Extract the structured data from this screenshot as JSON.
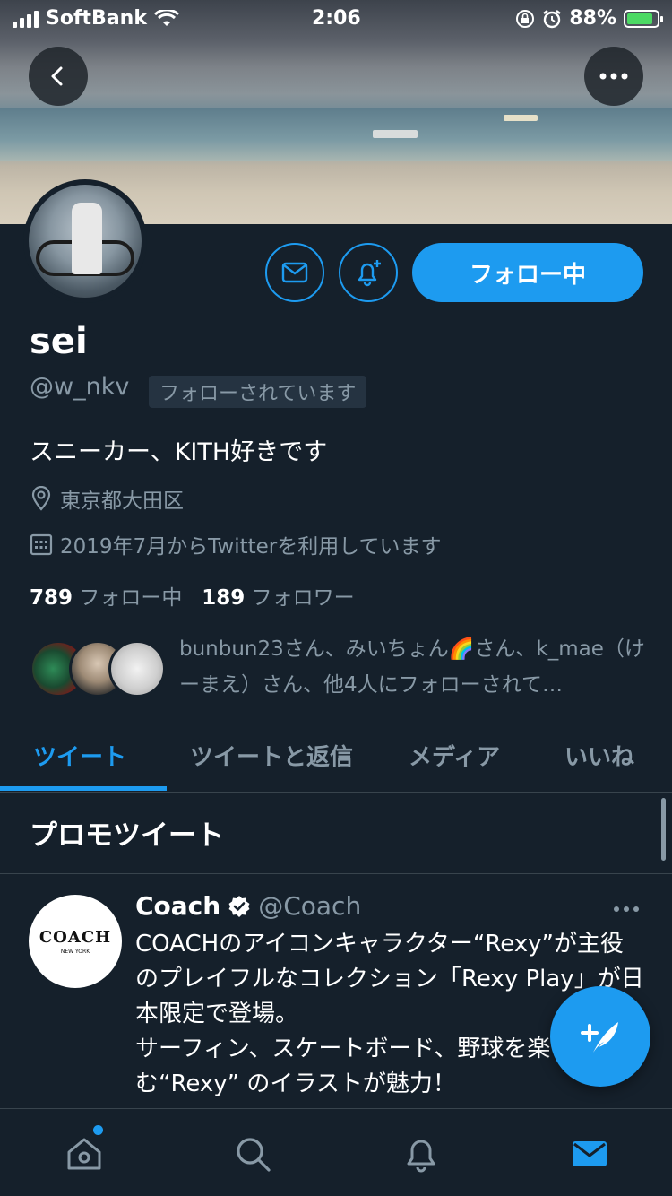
{
  "status_bar": {
    "carrier": "SoftBank",
    "time": "2:06",
    "battery": "88%"
  },
  "profile": {
    "name": "sei",
    "handle": "@w_nkv",
    "follows_you": "フォローされています",
    "bio": "スニーカー、KITH好きです",
    "location": "東京都大田区",
    "joined": "2019年7月からTwitterを利用しています",
    "following_count": "789",
    "following_label": "フォロー中",
    "followers_count": "189",
    "followers_label": "フォロワー",
    "follow_button": "フォロー中",
    "mutuals_text": "bunbun23さん、みいちょん🌈さん、k_mae（けーまえ）さん、他4人にフォローされて…"
  },
  "tabs": [
    {
      "label": "ツイート"
    },
    {
      "label": "ツイートと返信"
    },
    {
      "label": "メディア"
    },
    {
      "label": "いいね"
    }
  ],
  "promo": {
    "heading": "プロモツイート",
    "tweet": {
      "name": "Coach",
      "handle": "@Coach",
      "avatar_logo": "COACH",
      "avatar_sub": "NEW YORK",
      "text": "COACHのアイコンキャラクター“Rexy”が主役のプレイフルなコレクション「Rexy Play」が日本限定で登場。\nサーフィン、スケートボード、野球を楽しむ“Rexy” のイラストが魅力！"
    }
  },
  "colors": {
    "accent": "#1d9bf0",
    "background": "#15202b",
    "muted": "#8899a6"
  },
  "icons": [
    "back-icon",
    "more-icon",
    "mail-icon",
    "bell-plus-icon",
    "location-icon",
    "calendar-icon",
    "verified-icon",
    "compose-icon",
    "home-icon",
    "search-icon",
    "notifications-icon",
    "messages-icon"
  ]
}
